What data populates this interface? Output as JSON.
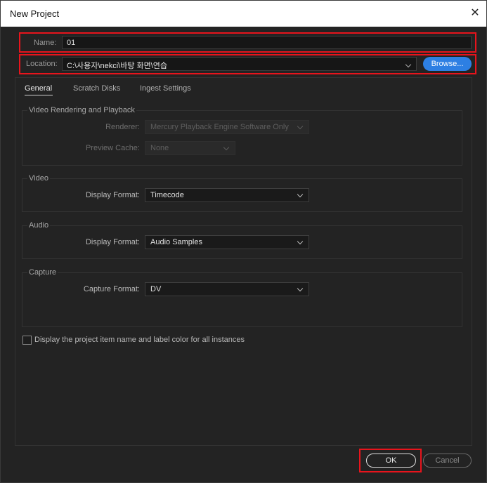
{
  "window": {
    "title": "New Project"
  },
  "name_field": {
    "label": "Name:",
    "value": "01"
  },
  "location_field": {
    "label": "Location:",
    "value": "C:\\사용자\\nekci\\바탕 화면\\연습"
  },
  "browse_label": "Browse...",
  "tabs": [
    {
      "label": "General",
      "active": true
    },
    {
      "label": "Scratch Disks",
      "active": false
    },
    {
      "label": "Ingest Settings",
      "active": false
    }
  ],
  "video_rendering": {
    "title": "Video Rendering and Playback",
    "renderer_label": "Renderer:",
    "renderer_value": "Mercury Playback Engine Software Only",
    "preview_cache_label": "Preview Cache:",
    "preview_cache_value": "None"
  },
  "video": {
    "title": "Video",
    "display_format_label": "Display Format:",
    "display_format_value": "Timecode"
  },
  "audio": {
    "title": "Audio",
    "display_format_label": "Display Format:",
    "display_format_value": "Audio Samples"
  },
  "capture": {
    "title": "Capture",
    "capture_format_label": "Capture Format:",
    "capture_format_value": "DV"
  },
  "checkbox": {
    "label": "Display the project item name and label color for all instances",
    "checked": false
  },
  "buttons": {
    "ok": "OK",
    "cancel": "Cancel"
  },
  "colors": {
    "accent": "#2d7fe3",
    "highlight": "#e8141c",
    "titlebar": "#ffffff",
    "background": "#232323"
  },
  "icons": {
    "close": "close-icon",
    "chevron": "chevron-down-icon"
  }
}
